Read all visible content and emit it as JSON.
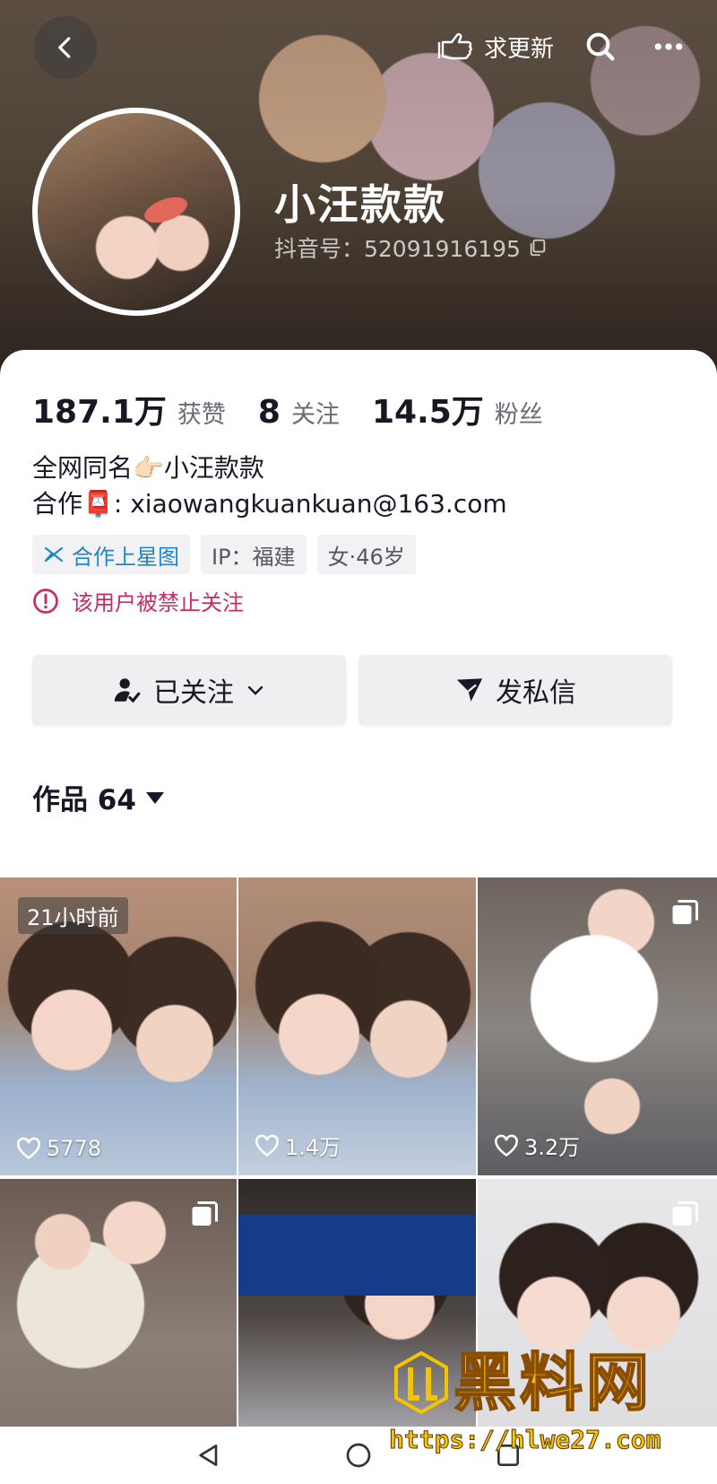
{
  "header": {
    "update_label": "求更新",
    "nickname": "小汪款款",
    "douyin_id": "抖音号：52091916195"
  },
  "stats": [
    {
      "value": "187.1万",
      "label": "获赞"
    },
    {
      "value": "8",
      "label": "关注"
    },
    {
      "value": "14.5万",
      "label": "粉丝"
    }
  ],
  "bio": {
    "line1_prefix": "全网同名",
    "line1_emoji": "👉🏻",
    "line1_suffix": "小汪款款",
    "line2_prefix": "合作",
    "line2_emoji": "📮",
    "line2_suffix": ": xiaowangkuankuan@163.com"
  },
  "tags": {
    "star": "合作上星图",
    "ip": "IP：福建",
    "gender_age": "女·46岁"
  },
  "notice": "该用户被禁止关注",
  "actions": {
    "follow": "已关注",
    "message": "发私信"
  },
  "works": {
    "label": "作品 64"
  },
  "videos": [
    {
      "badge": "21小时前",
      "likes": "5778"
    },
    {
      "likes": "1.4万"
    },
    {
      "likes": "3.2万"
    },
    {},
    {},
    {}
  ],
  "watermark": {
    "title": "黑料网",
    "url": "https://hlwe27.com"
  },
  "colors": {
    "accent_red": "#c92c66",
    "star_blue": "#1c87c9",
    "watermark_yellow": "#f5c400"
  }
}
